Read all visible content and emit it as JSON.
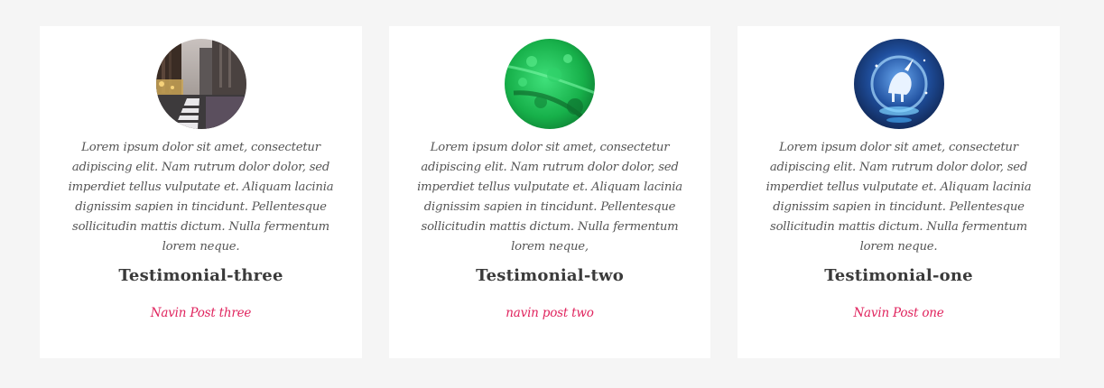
{
  "colors": {
    "background": "#f5f5f5",
    "card": "#ffffff",
    "text": "#555555",
    "heading": "#3a3a3a",
    "accent": "#e0245e"
  },
  "testimonials": [
    {
      "image": "city-street-photo",
      "quote": "Lorem ipsum dolor sit amet, consectetur adipiscing elit. Nam rutrum dolor dolor, sed imperdiet tellus vulputate et. Aliquam lacinia dignissim sapien in tincidunt. Pellentesque sollicitudin mattis dictum. Nulla fermentum lorem neque.",
      "name": "Testimonial-three",
      "role": "Navin Post three"
    },
    {
      "image": "green-fern-photo",
      "quote": "Lorem ipsum dolor sit amet, consectetur adipiscing elit. Nam rutrum dolor dolor, sed imperdiet tellus vulputate et. Aliquam lacinia dignissim sapien in tincidunt. Pellentesque sollicitudin mattis dictum. Nulla fermentum lorem neque,",
      "name": "Testimonial-two",
      "role": "navin post two"
    },
    {
      "image": "unicorn-moon-photo",
      "quote": "Lorem ipsum dolor sit amet, consectetur adipiscing elit. Nam rutrum dolor dolor, sed imperdiet tellus vulputate et. Aliquam lacinia dignissim sapien in tincidunt. Pellentesque sollicitudin mattis dictum. Nulla fermentum lorem neque.",
      "name": "Testimonial-one",
      "role": "Navin Post one"
    }
  ]
}
